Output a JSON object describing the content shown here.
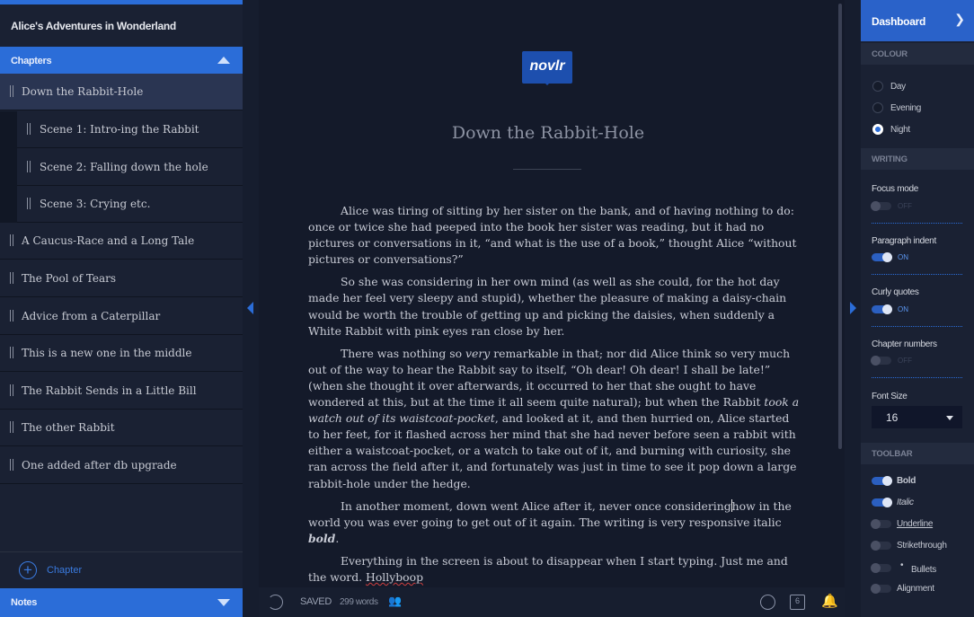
{
  "book": {
    "title": "Alice's Adventures in Wonderland"
  },
  "sidebar": {
    "chapters_label": "Chapters",
    "add_chapter_label": "Chapter",
    "notes_label": "Notes",
    "items": [
      {
        "label": "Down the Rabbit-Hole",
        "kind": "chapter",
        "active": true
      },
      {
        "label": "Scene 1: Intro-ing the Rabbit",
        "kind": "scene"
      },
      {
        "label": "Scene 2: Falling down the hole",
        "kind": "scene"
      },
      {
        "label": "Scene 3: Crying etc.",
        "kind": "scene"
      },
      {
        "label": "A Caucus-Race and a Long Tale",
        "kind": "chapter"
      },
      {
        "label": "The Pool of Tears",
        "kind": "chapter"
      },
      {
        "label": "Advice from a Caterpillar",
        "kind": "chapter"
      },
      {
        "label": "This is a new one in the middle",
        "kind": "chapter"
      },
      {
        "label": "The Rabbit Sends in a Little Bill",
        "kind": "chapter"
      },
      {
        "label": "The other Rabbit",
        "kind": "chapter"
      },
      {
        "label": "One added after db upgrade",
        "kind": "chapter"
      }
    ]
  },
  "editor": {
    "logo": "novlr",
    "chapter_title": "Down the Rabbit-Hole",
    "paragraphs": [
      [
        {
          "t": "Alice was tiring of sitting by her sister on the bank, and of having nothing to do: once or twice she had peeped into the book her sister was reading, but it had no pictures or conversations in it, “and what is the use of a book,” thought Alice “without pictures or conversations?”"
        }
      ],
      [
        {
          "t": "So she was considering in her own mind (as well as she could, for the hot day made her feel very sleepy and stupid), whether the pleasure of making a daisy-chain would be worth the trouble of getting up and picking the daisies, when suddenly a White Rabbit with pink eyes ran close by her."
        }
      ],
      [
        {
          "t": "There was nothing so "
        },
        {
          "t": "very",
          "i": true
        },
        {
          "t": " remarkable in that; nor did Alice think so very much out of the way to hear the Rabbit say to itself, “Oh dear! Oh dear! I shall be late!” (when she thought it over afterwards, it occurred to her that she ought to have wondered at this, but at the time it all seem quite natural); but when the Rabbit "
        },
        {
          "t": "took a watch out of its waistcoat-pocket",
          "i": true
        },
        {
          "t": ", and looked at it, and then hurried on, Alice started to her feet, for it flashed across her mind that she had never before seen a rabbit with either a waistcoat-pocket, or a watch to take out of it, and burning with curiosity, she ran across the field after it, and fortunately was just in time to see it pop down a large rabbit-hole under the hedge."
        }
      ],
      [
        {
          "t": "In another moment, down went Alice after it, never once considering"
        },
        {
          "caret": true
        },
        {
          "t": "how in the world you was ever going to get out of it again. The writing is very responsive italic "
        },
        {
          "t": "bold",
          "i": true,
          "b": true
        },
        {
          "t": "."
        }
      ],
      [
        {
          "t": "Everything in the screen is about to disappear when I start typing. Just me and the word. "
        },
        {
          "t": "Hollyboop",
          "sp": true
        }
      ]
    ]
  },
  "status": {
    "saved": "SAVED",
    "words": "299 words",
    "comment_count": "6"
  },
  "panel": {
    "dashboard": "Dashboard",
    "colour": {
      "section": "COLOUR",
      "options": [
        "Day",
        "Evening",
        "Night"
      ],
      "selected": "Night"
    },
    "writing": {
      "section": "WRITING",
      "focus_mode": {
        "label": "Focus mode",
        "state": "OFF",
        "on": false
      },
      "paragraph_indent": {
        "label": "Paragraph indent",
        "state": "ON",
        "on": true
      },
      "curly_quotes": {
        "label": "Curly quotes",
        "state": "ON",
        "on": true
      },
      "chapter_numbers": {
        "label": "Chapter numbers",
        "state": "OFF",
        "on": false
      },
      "font_size": {
        "label": "Font Size",
        "value": "16"
      }
    },
    "toolbar": {
      "section": "TOOLBAR",
      "items": [
        {
          "label": "Bold",
          "on": true
        },
        {
          "label": "Italic",
          "on": true
        },
        {
          "label": "Underline",
          "on": false
        },
        {
          "label": "Strikethrough",
          "on": false
        },
        {
          "label": "Bullets",
          "on": false
        },
        {
          "label": "Alignment",
          "on": false
        }
      ]
    }
  },
  "colors": {
    "accent": "#2b6dd8",
    "background": "#141a2a",
    "sidebar": "#1a2133"
  }
}
